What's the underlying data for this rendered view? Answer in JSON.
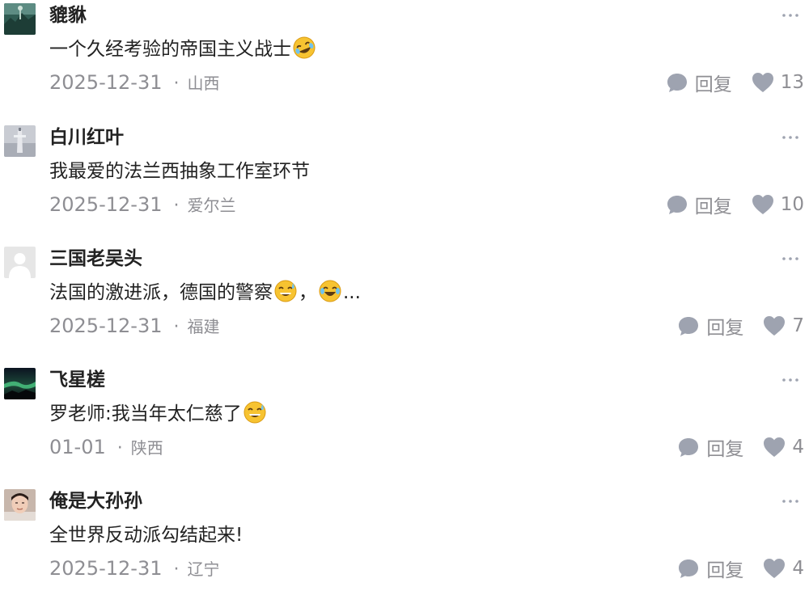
{
  "reply_label": "回复",
  "more_glyph": "···",
  "colors": {
    "text": "#222222",
    "meta": "#8e8e93",
    "icon": "#9ea3b0"
  },
  "comments": [
    {
      "username": "貔貅",
      "text": "一个久经考验的帝国主义战士",
      "emojis": [
        "rofl-emoji"
      ],
      "date": "2025-12-31",
      "location": "山西",
      "likes": "13",
      "avatar": "green-landscape"
    },
    {
      "username": "白川红叶",
      "text": "我最爱的法兰西抽象工作室环节",
      "emojis": [],
      "date": "2025-12-31",
      "location": "爱尔兰",
      "likes": "10",
      "avatar": "gray-statue"
    },
    {
      "username": "三国老吴头",
      "text": "法国的激进派，德国的警察",
      "text_mid": "，",
      "text_end": "...",
      "emojis": [
        "sweat-smile-emoji",
        "joy-emoji"
      ],
      "date": "2025-12-31",
      "location": "福建",
      "likes": "7",
      "avatar": "default-gray"
    },
    {
      "username": "飞星槎",
      "text": "罗老师:我当年太仁慈了",
      "emojis": [
        "sweat-smile-emoji"
      ],
      "date": "01-01",
      "location": "陕西",
      "likes": "4",
      "avatar": "aurora-night"
    },
    {
      "username": "俺是大孙孙",
      "text": "全世界反动派勾结起来!",
      "emojis": [],
      "date": "2025-12-31",
      "location": "辽宁",
      "likes": "4",
      "avatar": "person-photo"
    }
  ]
}
